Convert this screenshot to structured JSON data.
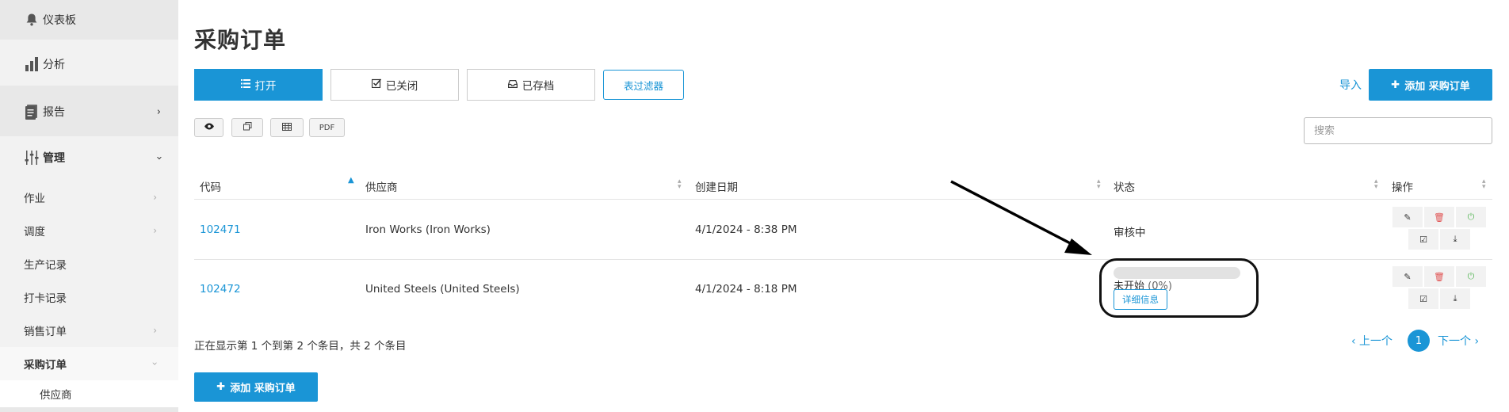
{
  "sidebar": {
    "dashboard": {
      "label": "仪表板",
      "icon": "bell-icon"
    },
    "analytics": {
      "label": "分析",
      "icon": "bar-chart-icon"
    },
    "reports": {
      "label": "报告",
      "icon": "report-icon"
    },
    "manage": {
      "label": "管理",
      "icon": "sliders-icon"
    },
    "sub_items": [
      {
        "label": "作业"
      },
      {
        "label": "调度"
      },
      {
        "label": "生产记录"
      },
      {
        "label": "打卡记录"
      },
      {
        "label": "销售订单"
      },
      {
        "label": "采购订单"
      }
    ],
    "child_item": {
      "label": "供应商"
    }
  },
  "main": {
    "title": "采购订单",
    "tabs": [
      {
        "label": "打开",
        "icon": "list-icon",
        "active": true
      },
      {
        "label": "已关闭",
        "icon": "check-square-icon",
        "active": false
      },
      {
        "label": "已存档",
        "icon": "inbox-icon",
        "active": false
      }
    ],
    "filter_label": "表过滤器",
    "import_label": "导入",
    "add_label": "添加 采购订单",
    "tool_buttons": [
      {
        "icon": "eye-icon"
      },
      {
        "icon": "copy-icon"
      },
      {
        "icon": "table-icon"
      },
      {
        "label": "PDF"
      }
    ],
    "search_placeholder": "搜索"
  },
  "table": {
    "headers": [
      "代码",
      "供应商",
      "创建日期",
      "状态",
      "操作"
    ],
    "rows": [
      {
        "code": "102471",
        "supplier": "Iron Works (Iron Works)",
        "created": "4/1/2024 - 8:38 PM",
        "status": "审核中"
      },
      {
        "code": "102472",
        "supplier": "United Steels (United Steels)",
        "created": "4/1/2024 - 8:18 PM",
        "status": "未开始",
        "status_pct": "(0%)",
        "progress": 0,
        "detail_label": "详细信息"
      }
    ]
  },
  "footer": {
    "info": "正在显示第 1 个到第 2 个条目，共 2 个条目",
    "prev": "‹ 上一个",
    "current_page": "1",
    "next": "下一个 ›",
    "add_label": "添加 采购订单"
  },
  "colors": {
    "accent": "#1a95d6",
    "delete": "#e05252",
    "power": "#5cb85c"
  }
}
